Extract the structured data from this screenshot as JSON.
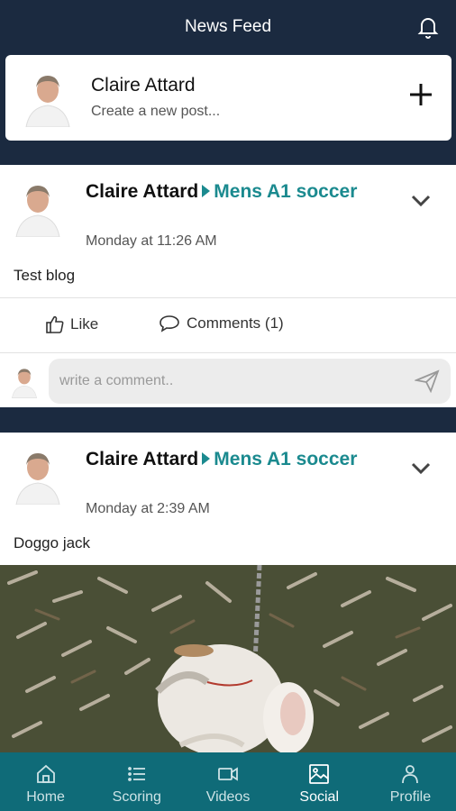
{
  "header": {
    "title": "News Feed",
    "icon": "bell-icon"
  },
  "create_post": {
    "name": "Claire Attard",
    "placeholder": "Create a new post...",
    "icon": "plus-icon"
  },
  "posts": [
    {
      "author": "Claire Attard",
      "group": "Mens A1 soccer",
      "time": "Monday at 11:26 AM",
      "text": "Test blog",
      "like_label": "Like",
      "comments_label": "Comments (1)",
      "comment_placeholder": "write a comment.."
    },
    {
      "author": "Claire Attard",
      "group": "Mens A1 soccer",
      "time": "Monday at 2:39 AM",
      "text": "Doggo jack"
    }
  ],
  "tabs": [
    {
      "label": "Home",
      "icon": "home-icon"
    },
    {
      "label": "Scoring",
      "icon": "list-icon"
    },
    {
      "label": "Videos",
      "icon": "video-icon"
    },
    {
      "label": "Social",
      "icon": "image-icon",
      "active": true
    },
    {
      "label": "Profile",
      "icon": "person-icon"
    }
  ],
  "colors": {
    "navy": "#1b2a40",
    "teal": "#1b8a8f",
    "tabbar": "#0f6b78"
  }
}
